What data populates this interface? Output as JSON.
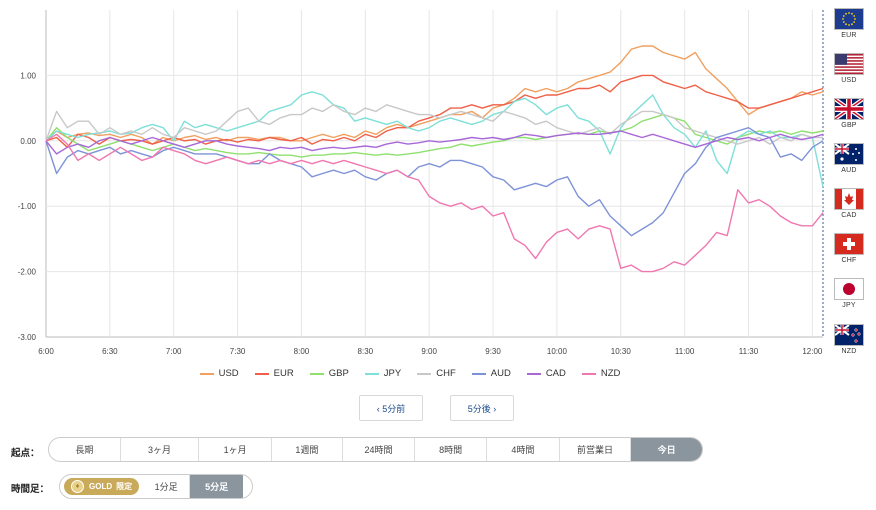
{
  "chart_data": {
    "type": "line",
    "x": [
      "6:00",
      "6:05",
      "6:10",
      "6:15",
      "6:20",
      "6:25",
      "6:30",
      "6:35",
      "6:40",
      "6:45",
      "6:50",
      "6:55",
      "7:00",
      "7:05",
      "7:10",
      "7:15",
      "7:20",
      "7:25",
      "7:30",
      "7:35",
      "7:40",
      "7:45",
      "7:50",
      "7:55",
      "8:00",
      "8:05",
      "8:10",
      "8:15",
      "8:20",
      "8:25",
      "8:30",
      "8:35",
      "8:40",
      "8:45",
      "8:50",
      "8:55",
      "9:00",
      "9:05",
      "9:10",
      "9:15",
      "9:20",
      "9:25",
      "9:30",
      "9:35",
      "9:40",
      "9:45",
      "9:50",
      "9:55",
      "10:00",
      "10:05",
      "10:10",
      "10:15",
      "10:20",
      "10:25",
      "10:30",
      "10:35",
      "10:40",
      "10:45",
      "10:50",
      "10:55",
      "11:00",
      "11:05",
      "11:10",
      "11:15",
      "11:20",
      "11:25",
      "11:30",
      "11:35",
      "11:40",
      "11:45",
      "11:50",
      "11:55",
      "12:00",
      "12:05"
    ],
    "xticks": [
      "6:00",
      "6:30",
      "7:00",
      "7:30",
      "8:00",
      "8:30",
      "9:00",
      "9:30",
      "10:00",
      "10:30",
      "11:00",
      "11:30",
      "12:00"
    ],
    "yticks": [
      "1.00",
      "0.00",
      "-1.00",
      "-2.00",
      "-3.00"
    ],
    "ylim": [
      -3,
      2
    ],
    "grid": true,
    "legend": "bottom",
    "series": [
      {
        "name": "USD",
        "color": "#f0a060",
        "values": [
          0,
          0.15,
          0.05,
          0.1,
          0.12,
          0.08,
          0.1,
          0.05,
          0.1,
          0.05,
          -0.05,
          0.05,
          0,
          0.05,
          0.08,
          0.02,
          0.05,
          0,
          0.05,
          0.05,
          0.02,
          0.05,
          0.05,
          0,
          0,
          0.05,
          0.1,
          0.05,
          0.1,
          0.05,
          0.15,
          0.1,
          0.2,
          0.25,
          0.2,
          0.25,
          0.3,
          0.35,
          0.4,
          0.4,
          0.45,
          0.35,
          0.5,
          0.55,
          0.65,
          0.8,
          0.75,
          0.8,
          0.75,
          0.8,
          0.9,
          0.95,
          1.0,
          1.05,
          1.2,
          1.4,
          1.45,
          1.45,
          1.35,
          1.3,
          1.25,
          1.35,
          1.1,
          0.95,
          0.8,
          0.6,
          0.4,
          0.5,
          0.55,
          0.6,
          0.65,
          0.75,
          0.7,
          0.75
        ]
      },
      {
        "name": "EUR",
        "color": "#f06048",
        "values": [
          0,
          0.05,
          -0.1,
          0.1,
          0.05,
          -0.05,
          0.05,
          0,
          0.02,
          0,
          -0.05,
          0,
          0.05,
          0,
          0.02,
          -0.05,
          0,
          0.02,
          -0.02,
          0.02,
          0,
          0.05,
          0.02,
          0,
          0.05,
          -0.05,
          0.02,
          0,
          0.05,
          0,
          0.1,
          0.05,
          0.15,
          0.2,
          0.2,
          0.3,
          0.35,
          0.4,
          0.5,
          0.5,
          0.55,
          0.5,
          0.55,
          0.55,
          0.6,
          0.7,
          0.65,
          0.7,
          0.7,
          0.75,
          0.8,
          0.8,
          0.85,
          0.75,
          0.9,
          0.95,
          1.0,
          1.0,
          0.9,
          0.85,
          0.8,
          0.85,
          0.75,
          0.7,
          0.65,
          0.6,
          0.5,
          0.5,
          0.55,
          0.6,
          0.65,
          0.7,
          0.75,
          0.8
        ]
      },
      {
        "name": "GBP",
        "color": "#90e070",
        "values": [
          0,
          0.2,
          0.05,
          -0.05,
          -0.15,
          -0.1,
          -0.05,
          0,
          -0.05,
          -0.1,
          -0.15,
          -0.1,
          -0.05,
          -0.1,
          -0.15,
          -0.12,
          -0.15,
          -0.18,
          -0.2,
          -0.2,
          -0.18,
          -0.2,
          -0.22,
          -0.22,
          -0.25,
          -0.22,
          -0.22,
          -0.2,
          -0.2,
          -0.18,
          -0.2,
          -0.22,
          -0.2,
          -0.22,
          -0.2,
          -0.18,
          -0.15,
          -0.12,
          -0.1,
          -0.05,
          -0.08,
          -0.05,
          -0.02,
          0,
          0.05,
          0.05,
          0.02,
          0.05,
          0.08,
          0.1,
          0.12,
          0.1,
          0.15,
          0.12,
          0.15,
          0.2,
          0.3,
          0.35,
          0.4,
          0.35,
          0.3,
          0.1,
          0.05,
          0,
          -0.05,
          0.05,
          0.1,
          0.15,
          0.12,
          0.15,
          0.1,
          0.15,
          0.12,
          0.15
        ]
      },
      {
        "name": "JPY",
        "color": "#7ee0d8",
        "values": [
          0,
          0.15,
          0.1,
          0.05,
          0.1,
          0.12,
          0.15,
          0.1,
          0.12,
          0.2,
          0.25,
          0.2,
          0,
          0.3,
          0.2,
          0.25,
          0.2,
          0.15,
          0.2,
          0.25,
          0.3,
          0.45,
          0.5,
          0.55,
          0.7,
          0.75,
          0.7,
          0.55,
          0.5,
          0.3,
          0.35,
          0.3,
          0.25,
          0.3,
          0.2,
          0.15,
          0.2,
          0.3,
          0.35,
          0.3,
          0.25,
          0.3,
          0.4,
          0.45,
          0.6,
          0.65,
          0.55,
          0.4,
          0.5,
          0.55,
          0.35,
          0.3,
          0.15,
          -0.2,
          0.2,
          0.4,
          0.55,
          0.7,
          0.4,
          0.2,
          0.1,
          -0.1,
          0.15,
          -0.3,
          -0.5,
          0.05,
          0.15,
          0.1,
          0.15,
          0.05,
          0.05,
          0.1,
          0.05,
          -0.7
        ]
      },
      {
        "name": "CHF",
        "color": "#c8c8c8",
        "values": [
          0,
          0.45,
          0.2,
          0.3,
          0.3,
          0.1,
          0.2,
          0.1,
          0.15,
          0.1,
          0.2,
          0.1,
          0.05,
          0.2,
          0.15,
          0.1,
          0.15,
          0.3,
          0.45,
          0.5,
          0.3,
          0.25,
          0.35,
          0.4,
          0.4,
          0.5,
          0.45,
          0.55,
          0.45,
          0.4,
          0.5,
          0.45,
          0.55,
          0.5,
          0.45,
          0.4,
          0.4,
          0.35,
          0.4,
          0.45,
          0.4,
          0.35,
          0.3,
          0.45,
          0.4,
          0.35,
          0.25,
          0.3,
          0.2,
          0.15,
          0.1,
          0.15,
          0.2,
          0.1,
          0.25,
          0.35,
          0.45,
          0.45,
          0.4,
          0.35,
          0.2,
          0.15,
          0.1,
          0.05,
          0,
          -0.05,
          0,
          0.05,
          -0.05,
          0.05,
          0,
          0.1,
          0.05,
          0.05
        ]
      },
      {
        "name": "AUD",
        "color": "#7e92d8",
        "values": [
          0,
          -0.5,
          -0.25,
          -0.15,
          -0.2,
          -0.15,
          -0.1,
          -0.2,
          -0.15,
          -0.2,
          -0.25,
          -0.15,
          -0.1,
          -0.15,
          -0.2,
          -0.2,
          -0.2,
          -0.25,
          -0.3,
          -0.35,
          -0.35,
          -0.2,
          -0.3,
          -0.35,
          -0.4,
          -0.55,
          -0.5,
          -0.45,
          -0.5,
          -0.45,
          -0.55,
          -0.6,
          -0.5,
          -0.45,
          -0.55,
          -0.4,
          -0.35,
          -0.4,
          -0.3,
          -0.3,
          -0.35,
          -0.4,
          -0.55,
          -0.6,
          -0.75,
          -0.7,
          -0.65,
          -0.7,
          -0.6,
          -0.55,
          -0.85,
          -1.0,
          -0.9,
          -1.15,
          -1.3,
          -1.45,
          -1.35,
          -1.25,
          -1.1,
          -0.8,
          -0.5,
          -0.35,
          -0.1,
          0.05,
          0.1,
          0.15,
          0.2,
          0.1,
          0.05,
          -0.25,
          -0.2,
          -0.3,
          -0.1,
          0
        ]
      },
      {
        "name": "CAD",
        "color": "#a868d8",
        "values": [
          0,
          -0.2,
          -0.1,
          -0.05,
          -0.1,
          0,
          0.05,
          0,
          -0.05,
          0,
          0.05,
          0,
          -0.05,
          -0.1,
          -0.05,
          0,
          0,
          -0.05,
          -0.08,
          -0.1,
          -0.12,
          -0.15,
          -0.1,
          -0.12,
          -0.1,
          -0.15,
          -0.12,
          -0.1,
          -0.12,
          -0.1,
          -0.08,
          -0.1,
          -0.05,
          -0.02,
          -0.05,
          -0.03,
          0,
          -0.02,
          0,
          0.02,
          0.05,
          0.03,
          0.05,
          0.02,
          0.05,
          0.1,
          0.08,
          0.05,
          0.08,
          0.1,
          0.12,
          0.1,
          0.1,
          0.12,
          0.15,
          0.1,
          0.05,
          0.1,
          0.05,
          0,
          -0.05,
          -0.1,
          -0.05,
          0,
          0.05,
          0.02,
          0.05,
          0,
          0.05,
          0.1,
          0.05,
          0.02,
          0.05,
          0.1
        ]
      },
      {
        "name": "NZD",
        "color": "#f078b0",
        "values": [
          0,
          0.1,
          -0.05,
          -0.3,
          -0.2,
          -0.3,
          -0.2,
          -0.1,
          -0.2,
          -0.3,
          -0.25,
          -0.1,
          -0.15,
          -0.2,
          -0.3,
          -0.35,
          -0.3,
          -0.25,
          -0.3,
          -0.35,
          -0.3,
          -0.35,
          -0.3,
          -0.35,
          -0.3,
          -0.35,
          -0.3,
          -0.35,
          -0.3,
          -0.35,
          -0.4,
          -0.45,
          -0.5,
          -0.45,
          -0.55,
          -0.6,
          -0.85,
          -0.95,
          -1.0,
          -0.95,
          -1.05,
          -1.0,
          -1.15,
          -1.1,
          -1.5,
          -1.6,
          -1.8,
          -1.55,
          -1.4,
          -1.35,
          -1.5,
          -1.35,
          -1.3,
          -1.35,
          -1.95,
          -1.9,
          -2.0,
          -2.0,
          -1.95,
          -1.85,
          -1.9,
          -1.75,
          -1.6,
          -1.4,
          -1.45,
          -0.75,
          -0.95,
          -0.9,
          -1.0,
          -1.15,
          -1.25,
          -1.3,
          -1.3,
          -1.1
        ]
      }
    ]
  },
  "flags": [
    {
      "code": "EUR",
      "icon": "eu-flag-icon"
    },
    {
      "code": "USD",
      "icon": "us-flag-icon"
    },
    {
      "code": "GBP",
      "icon": "uk-flag-icon"
    },
    {
      "code": "AUD",
      "icon": "au-flag-icon"
    },
    {
      "code": "CAD",
      "icon": "ca-flag-icon"
    },
    {
      "code": "CHF",
      "icon": "ch-flag-icon"
    },
    {
      "code": "JPY",
      "icon": "jp-flag-icon"
    },
    {
      "code": "NZD",
      "icon": "nz-flag-icon"
    }
  ],
  "nav": {
    "prev": "‹ 5分前",
    "next": "5分後 ›"
  },
  "start_point": {
    "label": "起点：",
    "options": [
      "長期",
      "3ヶ月",
      "1ヶ月",
      "1週間",
      "24時間",
      "8時間",
      "4時間",
      "前営業日",
      "今日"
    ],
    "selected": "今日"
  },
  "timeframe": {
    "label": "時間足：",
    "gold_label": "GOLD",
    "gold_badge": "限定",
    "options": [
      "1分足",
      "5分足"
    ],
    "selected": "5分足"
  }
}
